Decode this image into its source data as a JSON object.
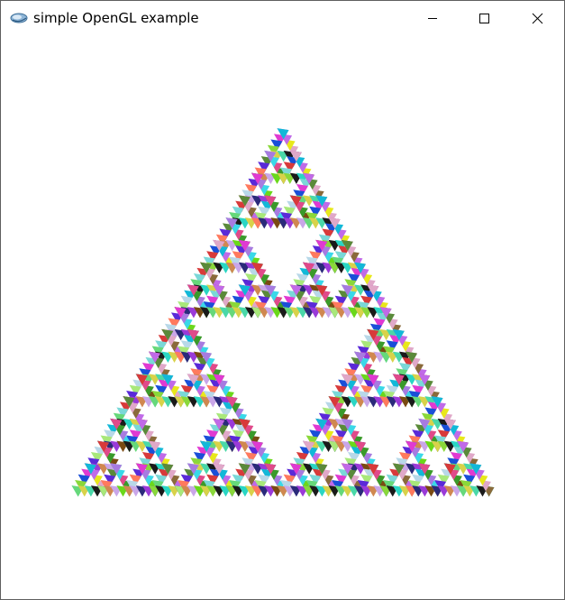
{
  "window": {
    "title": "simple OpenGL example",
    "icon": "opengl-app-icon",
    "controls": [
      {
        "name": "minimize",
        "icon": "minimize-icon"
      },
      {
        "name": "maximize",
        "icon": "maximize-icon"
      },
      {
        "name": "close",
        "icon": "close-icon"
      }
    ]
  },
  "canvas": {
    "background": "#ffffff",
    "content": "sierpinski-triangle-of-colored-triangles",
    "recursion_depth": 4,
    "marker_colors": [
      "#a77be0",
      "#7a4a12",
      "#d08850",
      "#5a2ad8",
      "#c06ae8",
      "#2ad6c4",
      "#66d87a",
      "#e03ad2",
      "#3a9a2a",
      "#c9a6e8",
      "#ff7a5e",
      "#12b8d8",
      "#8a6a3a",
      "#d8d24a",
      "#1a4fd8",
      "#e04a8a",
      "#6ad81a",
      "#2a2a7a",
      "#b8d8e8",
      "#e0a8c8",
      "#4ad8a8",
      "#8ad83a",
      "#d83a3a",
      "#3ad8e8",
      "#9a3ad8",
      "#a8e87a",
      "#5a8a3a",
      "#e8e81a",
      "#1a1a1a",
      "#7ad8d8"
    ]
  }
}
